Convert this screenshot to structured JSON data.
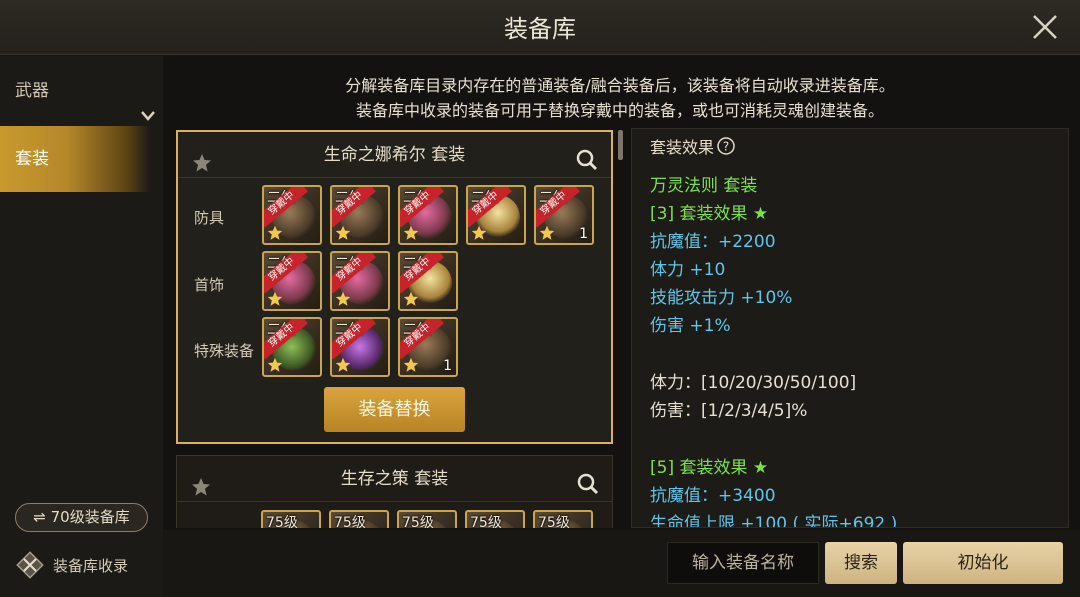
{
  "window": {
    "title": "装备库"
  },
  "sidebar": {
    "items": [
      {
        "label": "武器"
      },
      {
        "label": "套装"
      }
    ],
    "level_pill": "⇌ 70级装备库",
    "collect_label": "装备库收录"
  },
  "info": {
    "line1": "分解装备库目录内存在的普通装备/融合装备后，该装备将自动收录进装备库。",
    "line2": "装备库中收录的装备可用于替换穿戴中的装备，或也可消耗灵魂创建装备。"
  },
  "sets": [
    {
      "name": "生命之娜希尔  套装",
      "rows": [
        {
          "label": "防具"
        },
        {
          "label": "首饰"
        },
        {
          "label": "特殊装备"
        }
      ],
      "badge": "穿戴中",
      "slot_level_text": "二级",
      "count": "1",
      "swap_button": "装备替换"
    },
    {
      "name": "生存之策  套装",
      "slot_level": "75级"
    }
  ],
  "detail": {
    "header": "套装效果",
    "set_name": "万灵法则  套装",
    "tier3": "[3] 套装效果 ★",
    "tier3_lines": [
      "抗魔值：+2200",
      "体力 +10",
      "技能攻击力 +10%",
      "伤害 +1%"
    ],
    "scale1": "体力：[10/20/30/50/100]",
    "scale2": "伤害：[1/2/3/4/5]%",
    "tier5": "[5] 套装效果 ★",
    "tier5_lines": [
      "抗魔值：+3400",
      "生命值上限 +100 ( 实际+692 )"
    ]
  },
  "bottom": {
    "search_placeholder": "输入装备名称",
    "search_button": "搜索",
    "reset_button": "初始化"
  },
  "colors": {
    "accent_gold": "#d8b261",
    "set_green": "#7de04a",
    "stat_cyan": "#5fc6e8",
    "badge_red": "#c6232a"
  }
}
